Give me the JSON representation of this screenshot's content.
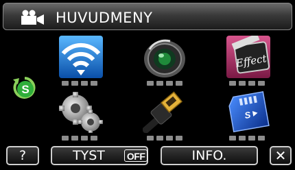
{
  "header": {
    "title": "HUVUDMENY",
    "icon": "video-camera-icon"
  },
  "menu": {
    "side_icon": "self-timer-icon",
    "side_icon_text": "S",
    "tiles": [
      {
        "name": "wifi",
        "icon": "wifi-icon"
      },
      {
        "name": "lens",
        "icon": "camera-lens-icon"
      },
      {
        "name": "effect",
        "icon": "effect-icon",
        "label": "Effect"
      },
      {
        "name": "settings",
        "icon": "gears-icon"
      },
      {
        "name": "hdmi",
        "icon": "hdmi-cable-icon"
      },
      {
        "name": "sd",
        "icon": "sd-card-icon",
        "label": "S"
      }
    ]
  },
  "bottom": {
    "help_label": "?",
    "tyst_label": "TYST",
    "tyst_state": "OFF",
    "info_label": "INFO.",
    "close_label": "✕"
  },
  "colors": {
    "wifi_blue": "#1a7fd8",
    "sd_blue": "#1a4fbf",
    "effect_pink": "#b5336d",
    "accent_green": "#2fae3a"
  }
}
